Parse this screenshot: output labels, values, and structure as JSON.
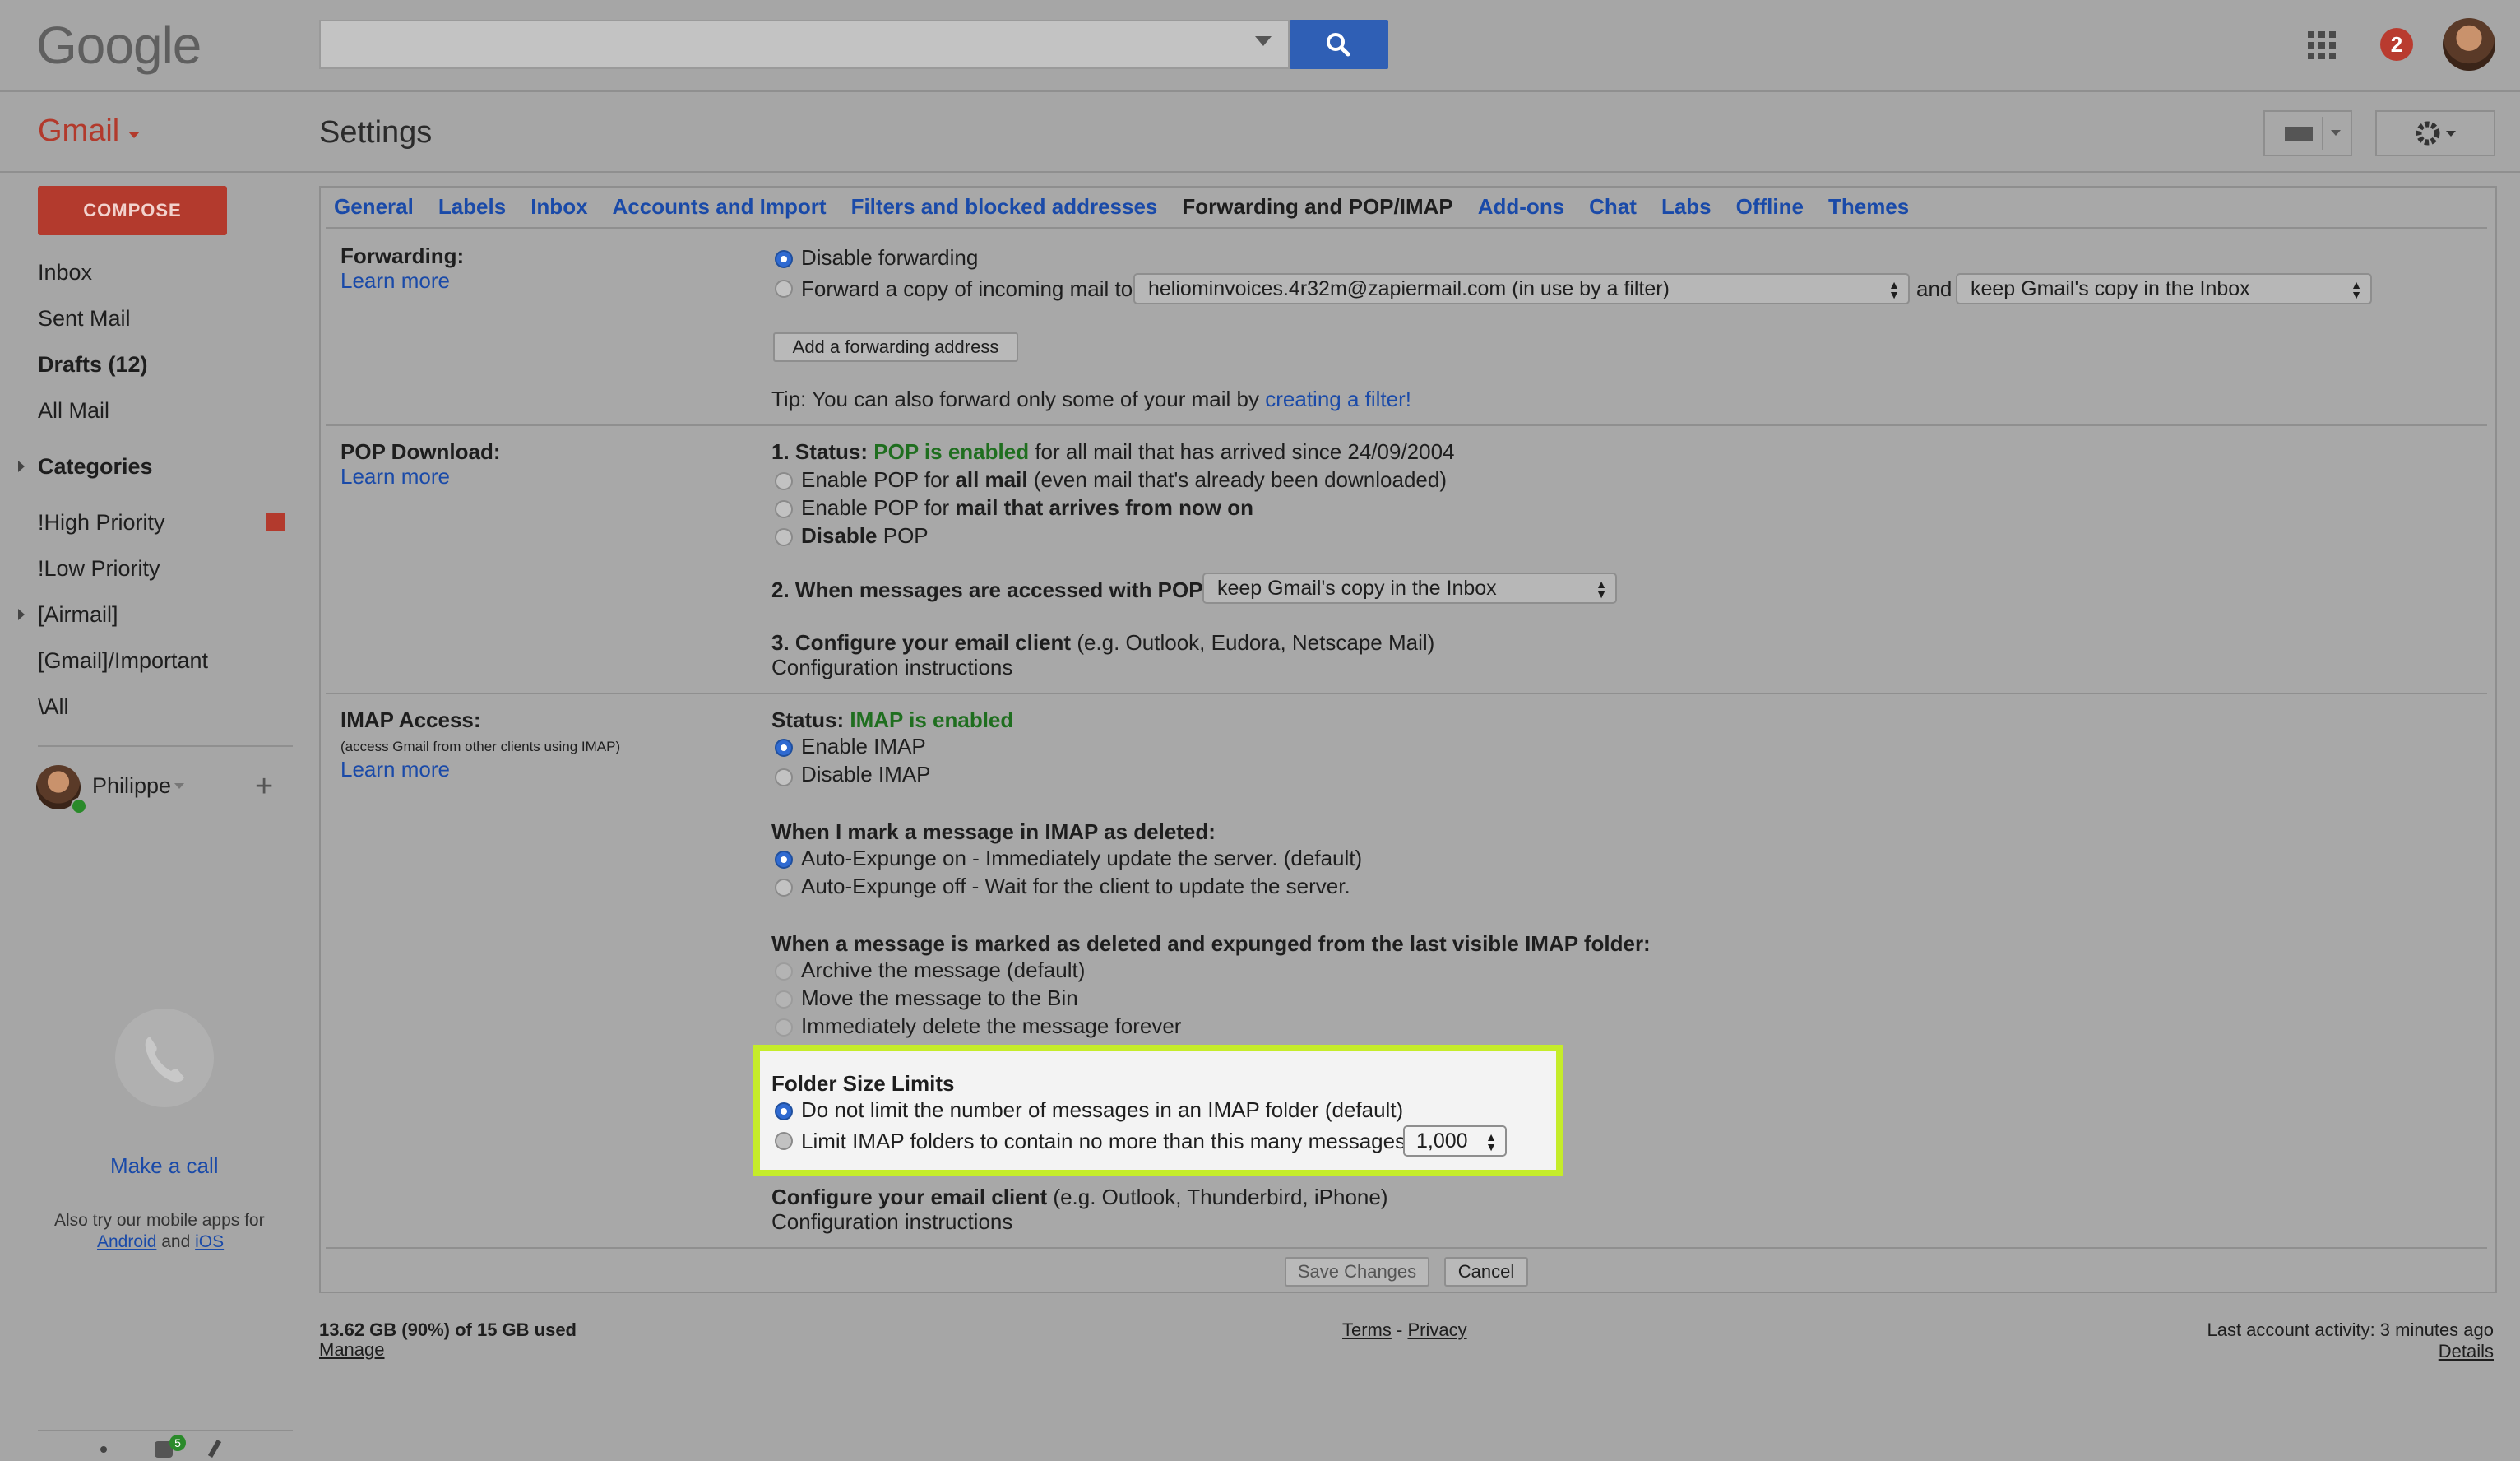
{
  "header": {
    "logo": "Google",
    "search_placeholder": "",
    "notification_count": "2"
  },
  "app": {
    "name": "Gmail",
    "page_title": "Settings"
  },
  "sidebar": {
    "compose": "COMPOSE",
    "items": [
      {
        "label": "Inbox",
        "bold": false
      },
      {
        "label": "Sent Mail",
        "bold": false
      },
      {
        "label": "Drafts (12)",
        "bold": true
      },
      {
        "label": "All Mail",
        "bold": false
      },
      {
        "label": "Categories",
        "bold": true
      },
      {
        "label": "!High Priority",
        "bold": false
      },
      {
        "label": "!Low Priority",
        "bold": false
      },
      {
        "label": "[Airmail]",
        "bold": false
      },
      {
        "label": "[Gmail]/Important",
        "bold": false
      },
      {
        "label": "\\All",
        "bold": false
      }
    ],
    "user_name": "Philippe",
    "make_call": "Make a call",
    "mobile_text": "Also try our mobile apps for",
    "android": "Android",
    "and": "and",
    "ios": "iOS",
    "footer_badge": "5"
  },
  "tabs": [
    "General",
    "Labels",
    "Inbox",
    "Accounts and Import",
    "Filters and blocked addresses",
    "Forwarding and POP/IMAP",
    "Add-ons",
    "Chat",
    "Labs",
    "Offline",
    "Themes"
  ],
  "forwarding": {
    "label": "Forwarding:",
    "learn_more": "Learn more",
    "disable": "Disable forwarding",
    "forward_copy": "Forward a copy of incoming mail to",
    "forward_address": "heliominvoices.4r32m@zapiermail.com (in use by a filter)",
    "and": "and",
    "keep_option": "keep Gmail's copy in the Inbox",
    "add_button": "Add a forwarding address",
    "tip": "Tip: You can also forward only some of your mail by",
    "tip_link": "creating a filter!"
  },
  "pop": {
    "label": "POP Download:",
    "learn_more": "Learn more",
    "status_prefix": "1. Status:",
    "status_value": "POP is enabled",
    "status_suffix": "for all mail that has arrived since 24/09/2004",
    "opt1_a": "Enable POP for",
    "opt1_b": "all mail",
    "opt1_c": "(even mail that's already been downloaded)",
    "opt2_a": "Enable POP for",
    "opt2_b": "mail that arrives from now on",
    "opt3_a": "Disable",
    "opt3_b": "POP",
    "access_label": "2. When messages are accessed with POP",
    "access_select": "keep Gmail's copy in the Inbox",
    "configure_label": "3. Configure your email client",
    "configure_hint": "(e.g. Outlook, Eudora, Netscape Mail)",
    "config_link": "Configuration instructions"
  },
  "imap": {
    "label": "IMAP Access:",
    "sublabel": "(access Gmail from other clients using IMAP)",
    "learn_more": "Learn more",
    "status_prefix": "Status:",
    "status_value": "IMAP is enabled",
    "enable": "Enable IMAP",
    "disable": "Disable IMAP",
    "deleted_heading": "When I mark a message in IMAP as deleted:",
    "expunge_on": "Auto-Expunge on - Immediately update the server. (default)",
    "expunge_off": "Auto-Expunge off - Wait for the client to update the server.",
    "expunged_heading": "When a message is marked as deleted and expunged from the last visible IMAP folder:",
    "archive": "Archive the message (default)",
    "move_bin": "Move the message to the Bin",
    "delete_forever": "Immediately delete the message forever",
    "folder_heading": "Folder Size Limits",
    "no_limit": "Do not limit the number of messages in an IMAP folder (default)",
    "limit": "Limit IMAP folders to contain no more than this many messages",
    "limit_value": "1,000",
    "configure_label": "Configure your email client",
    "configure_hint": "(e.g. Outlook, Thunderbird, iPhone)",
    "config_link": "Configuration instructions"
  },
  "actions": {
    "save": "Save Changes",
    "cancel": "Cancel"
  },
  "footer": {
    "storage": "13.62 GB (90%) of 15 GB used",
    "manage": "Manage",
    "terms": "Terms",
    "sep": "-",
    "privacy": "Privacy",
    "activity": "Last account activity: 3 minutes ago",
    "details": "Details"
  },
  "colors": {
    "highlight": "#c5ec2a",
    "accent": "#2f5fb5",
    "brand_red": "#b33a2d",
    "enabled_green": "#1f6e1f"
  }
}
